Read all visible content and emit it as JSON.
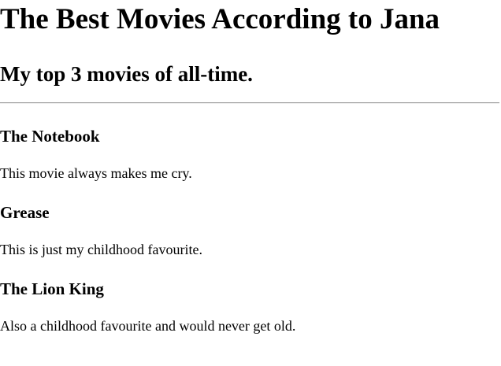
{
  "title": "The Best Movies According to Jana",
  "subtitle": "My top 3 movies of all-time.",
  "movies": [
    {
      "name": "The Notebook",
      "description": "This movie always makes me cry."
    },
    {
      "name": "Grease",
      "description": "This is just my childhood favourite."
    },
    {
      "name": "The Lion King",
      "description": "Also a childhood favourite and would never get old."
    }
  ]
}
